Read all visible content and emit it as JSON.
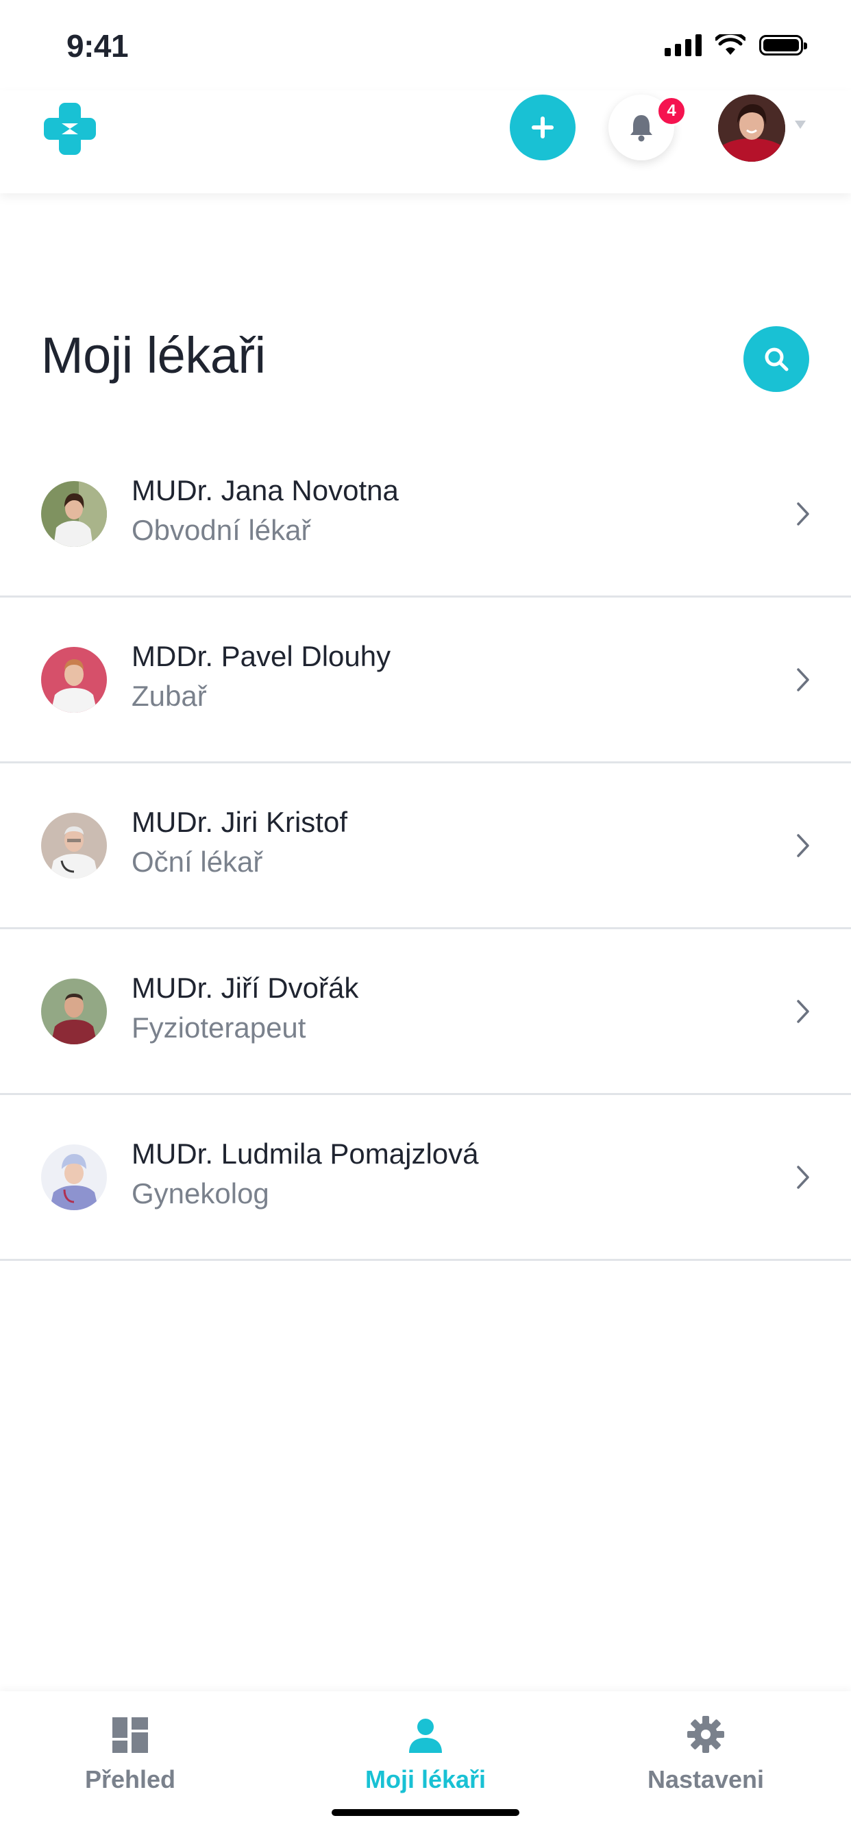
{
  "status": {
    "time": "9:41"
  },
  "header": {
    "notifications_count": "4"
  },
  "page": {
    "title": "Moji lékaři"
  },
  "doctors": [
    {
      "name": "MUDr. Jana Novotna",
      "specialty": "Obvodní lékař",
      "avatar_color": "#8a9a6a"
    },
    {
      "name": "MDDr. Pavel Dlouhy",
      "specialty": "Zubař",
      "avatar_color": "#d4546a"
    },
    {
      "name": "MUDr. Jiri Kristof",
      "specialty": "Oční lékař",
      "avatar_color": "#c9b8ad"
    },
    {
      "name": "MUDr. Jiří Dvořák",
      "specialty": "Fyzioterapeut",
      "avatar_color": "#8aa07a"
    },
    {
      "name": "MUDr. Ludmila Pomajzlová",
      "specialty": "Gynekolog",
      "avatar_color": "#dfe3ef"
    }
  ],
  "nav": {
    "items": [
      {
        "label": "Přehled",
        "icon": "dashboard-icon",
        "active": false
      },
      {
        "label": "Moji lékaři",
        "icon": "person-icon",
        "active": true
      },
      {
        "label": "Nastaveni",
        "icon": "gear-icon",
        "active": false
      }
    ]
  },
  "colors": {
    "accent": "#19c1d4",
    "badge": "#f5134f",
    "muted": "#7a818c",
    "text": "#1f2430"
  }
}
